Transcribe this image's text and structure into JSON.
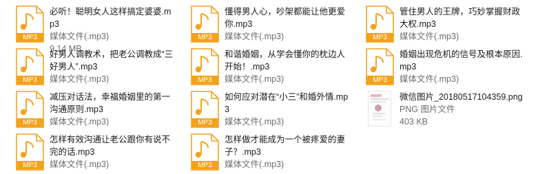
{
  "files": [
    {
      "name": "必听！聪明女人这样搞定婆婆.mp3",
      "type": "媒体文件(.mp3)",
      "size": "9.14 MB",
      "badge": "MP3"
    },
    {
      "name": "好男人调教术，把老公调教成“三好男人”.mp3",
      "type": "媒体文件(.mp3)",
      "size": "",
      "badge": "MP3"
    },
    {
      "name": "减压对话法，幸福婚姻里的第一沟通原则.mp3",
      "type": "媒体文件(.mp3)",
      "size": "",
      "badge": "MP3"
    },
    {
      "name": "怎样有效沟通让老公跟你有说不完的话.mp3",
      "type": "媒体文件(.mp3)",
      "size": "",
      "badge": "MP3"
    },
    {
      "name": "懂得男人心，吵架都能让他更爱你.mp3",
      "type": "媒体文件(.mp3)",
      "size": "",
      "badge": "MP3"
    },
    {
      "name": "和谐婚姻，从学会懂你的枕边人开始！.mp3",
      "type": "媒体文件(.mp3)",
      "size": "",
      "badge": "MP3"
    },
    {
      "name": "如何应对潜在“小三”和婚外情.mp3",
      "type": "媒体文件(.mp3)",
      "size": "",
      "badge": "MP3"
    },
    {
      "name": "怎样做才能成为一个被疼爱的妻子？.mp3",
      "type": "媒体文件(.mp3)",
      "size": "",
      "badge": "MP3"
    },
    {
      "name": "管住男人的王牌，巧妙掌握财政大权.mp3",
      "type": "媒体文件(.mp3)",
      "size": "",
      "badge": "MP3"
    },
    {
      "name": "婚姻出现危机的信号及根本原因.mp3",
      "type": "媒体文件(.mp3)",
      "size": "",
      "badge": "MP3"
    },
    {
      "name": "微信图片_20180517104359.png",
      "type": "PNG 图片文件",
      "size": "403 KB",
      "badge": ""
    }
  ],
  "colors": {
    "mp3_accent": "#f4a21e",
    "mp3_badge_bg": "#f4a21e"
  }
}
